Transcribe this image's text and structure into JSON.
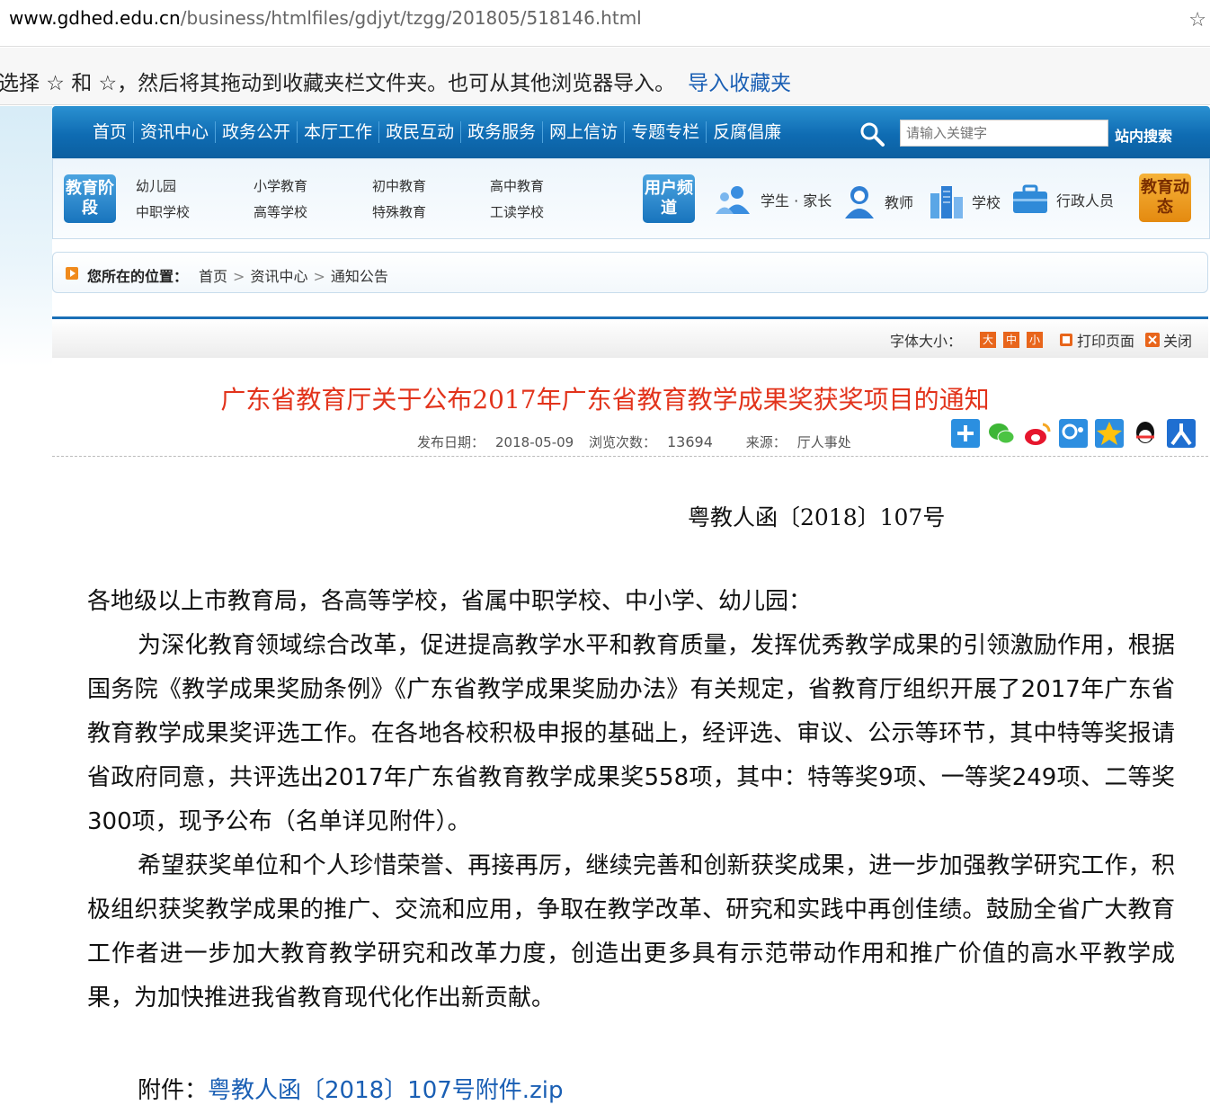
{
  "browser": {
    "url_host": "www.gdhed.edu.cn",
    "url_path": "/business/htmlfiles/gdjyt/tzgg/201805/518146.html"
  },
  "favorites_bar": {
    "message": "选择 ☆ 和 ☆，然后将其拖动到收藏夹栏文件夹。也可从其他浏览器导入。",
    "import_link": "导入收藏夹"
  },
  "nav": {
    "items": [
      "首页",
      "资讯中心",
      "政务公开",
      "本厅工作",
      "政民互动",
      "政务服务",
      "网上信访",
      "专题专栏",
      "反腐倡廉"
    ],
    "search_placeholder": "请输入关键字",
    "search_button": "站内搜索"
  },
  "panel": {
    "stage_badge": "教育阶段",
    "stages": [
      "幼儿园",
      "小学教育",
      "初中教育",
      "高中教育",
      "中职学校",
      "高等学校",
      "特殊教育",
      "工读学校"
    ],
    "user_badge": "用户频道",
    "user_channels": [
      "学生 · 家长",
      "教师",
      "学校",
      "行政人员"
    ],
    "news_badge": "教育动态"
  },
  "breadcrumb": {
    "label": "您所在的位置：",
    "items": [
      "首页",
      "资讯中心",
      "通知公告"
    ]
  },
  "toolbar": {
    "font_size_label": "字体大小：",
    "font_large": "大",
    "font_medium": "中",
    "font_small": "小",
    "print": "打印页面",
    "close": "关闭"
  },
  "article": {
    "title": "广东省教育厅关于公布2017年广东省教育教学成果奖获奖项目的通知",
    "publish_label": "发布日期：",
    "publish_date": "2018-05-09",
    "views_label": "浏览次数：",
    "views": "13694",
    "source_label": "来源：",
    "source": "厅人事处",
    "doc_number": "粤教人函〔2018〕107号",
    "salutation": "各地级以上市教育局，各高等学校，省属中职学校、中小学、幼儿园：",
    "para1": "为深化教育领域综合改革，促进提高教学水平和教育质量，发挥优秀教学成果的引领激励作用，根据国务院《教学成果奖励条例》《广东省教学成果奖励办法》有关规定，省教育厅组织开展了2017年广东省教育教学成果奖评选工作。在各地各校积极申报的基础上，经评选、审议、公示等环节，其中特等奖报请省政府同意，共评选出2017年广东省教育教学成果奖558项，其中：特等奖9项、一等奖249项、二等奖300项，现予公布（名单详见附件）。",
    "para2": "希望获奖单位和个人珍惜荣誉、再接再厉，继续完善和创新获奖成果，进一步加强教学研究工作，积极组织获奖教学成果的推广、交流和应用，争取在教学改革、研究和实践中再创佳绩。鼓励全省广大教育工作者进一步加大教育教学研究和改革力度，创造出更多具有示范带动作用和推广价值的高水平教学成果，为加快推进我省教育现代化作出新贡献。",
    "attachment_label": "附件：",
    "attachment_link": "粤教人函〔2018〕107号附件.zip"
  },
  "colors": {
    "nav_blue": "#0f6cb3",
    "title_red": "#e2331b",
    "link_blue": "#1a5fb4",
    "badge_orange": "#e48a10"
  }
}
